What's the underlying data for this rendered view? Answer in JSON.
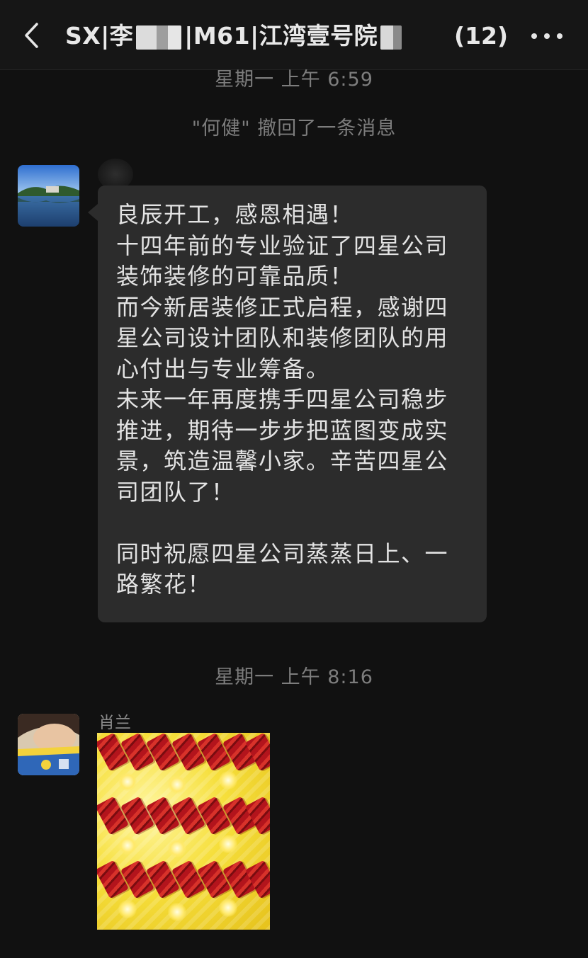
{
  "header": {
    "title_prefix": "SX|李",
    "title_mid": "|M61|江湾壹号院",
    "member_count": "(12)"
  },
  "messages": [
    {
      "type": "timestamp",
      "text": "星期一 上午 6:59"
    },
    {
      "type": "system",
      "text": "\"何健\" 撤回了一条消息"
    },
    {
      "type": "text",
      "lines": [
        "良辰开工，感恩相遇！",
        "十四年前的专业验证了四星公司",
        "装饰装修的可靠品质！",
        "而今新居装修正式启程，感谢四",
        "星公司设计团队和装修团队的用",
        "心付出与专业筹备。",
        "未来一年再度携手四星公司稳步",
        "推进，期待一步步把蓝图变成实",
        "景，筑造温馨小家。辛苦四星公",
        "司团队了！",
        "",
        "同时祝愿四星公司蒸蒸日上、一",
        "路繁花！"
      ]
    },
    {
      "type": "timestamp",
      "text": "星期一 上午 8:16"
    },
    {
      "type": "sticker",
      "sender": "肖兰"
    }
  ],
  "icons": {
    "back": "chevron-left-icon",
    "more": "more-dots-icon"
  },
  "colors": {
    "background": "#111111",
    "bubble": "#2c2c2c",
    "meta_text": "#7d7d7d"
  }
}
